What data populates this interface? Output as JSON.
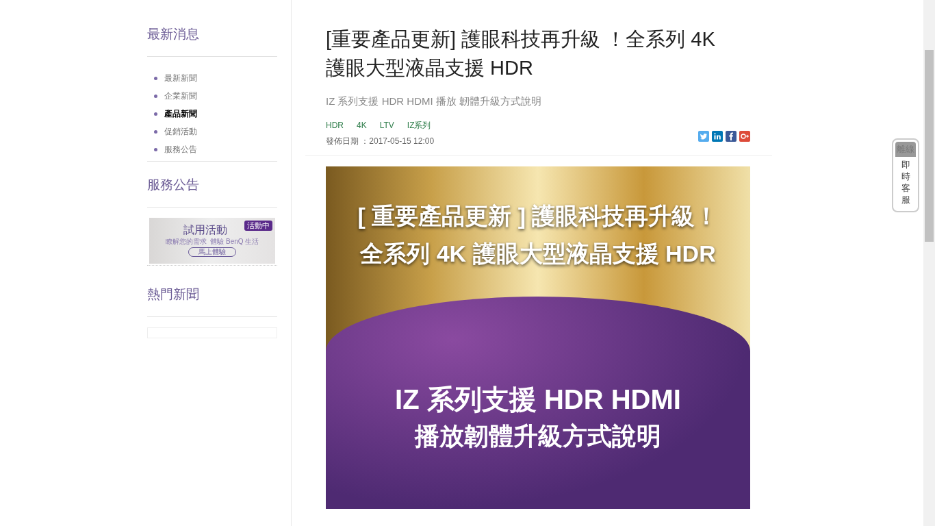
{
  "sidebar": {
    "sections": [
      {
        "title": "最新消息",
        "items": [
          {
            "label": "最新新聞",
            "selected": false
          },
          {
            "label": "企業新聞",
            "selected": false
          },
          {
            "label": "產品新聞",
            "selected": true
          },
          {
            "label": "促銷活動",
            "selected": false
          },
          {
            "label": "服務公告",
            "selected": false
          }
        ]
      },
      {
        "title": "服務公告",
        "ad": {
          "title": "試用活動",
          "badge": "活動中",
          "subtitle": "瞭解您的需求  體驗 BenQ 生活",
          "button": "馬上體驗"
        }
      },
      {
        "title": "熱門新聞"
      }
    ]
  },
  "article": {
    "title": "[重要產品更新] 護眼科技再升級 ！全系列 4K 護眼大型液晶支援 HDR",
    "subtitle": "IZ 系列支援 HDR HDMI 播放 韌體升級方式說明",
    "tags": [
      "HDR",
      "4K",
      "LTV",
      "IZ系列"
    ],
    "date": "發佈日期 ：2017-05-15 12:00",
    "share": [
      {
        "kind": "twitter"
      },
      {
        "kind": "linkedin"
      },
      {
        "kind": "facebook"
      },
      {
        "kind": "gplus"
      }
    ],
    "banner": {
      "line_1": "[ 重要產品更新 ] 護眼科技再升級！",
      "line_2": "全系列 4K 護眼大型液晶支援 HDR",
      "line_3": "IZ 系列支援 HDR HDMI",
      "line_4": "播放韌體升級方式說明"
    }
  },
  "chat_widget": {
    "status": "離線",
    "label": "即時客服"
  }
}
